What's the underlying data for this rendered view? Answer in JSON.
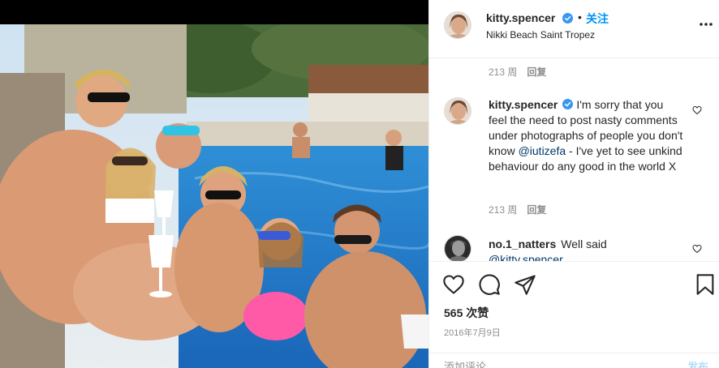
{
  "post": {
    "author": "kitty.spencer",
    "follow_label": "关注",
    "separator": "•",
    "location": "Nikki Beach Saint Tropez"
  },
  "comments": [
    {
      "meta_time": "213 周",
      "meta_reply": "回复"
    },
    {
      "username": "kitty.spencer",
      "text_before": "I'm sorry that you feel the need to post nasty comments under photographs of people you don't know ",
      "mention": "@iutizefa",
      "text_after": " - I've yet to see unkind behaviour do any good in the world X",
      "meta_time": "213 周",
      "meta_reply": "回复"
    },
    {
      "username": "no.1_natters",
      "text": "Well said",
      "mention": "@kitty.spencer"
    }
  ],
  "actions": {
    "likes": "565 次赞",
    "date": "2016年7月9日"
  },
  "add_comment": {
    "placeholder": "添加评论……",
    "post_label": "发布"
  },
  "colors": {
    "accent": "#0095f6",
    "verified": "#3897f0",
    "mention": "#00376b",
    "muted": "#8e8e8e"
  },
  "icons": [
    "verified-badge-icon",
    "more-options-icon",
    "heart-icon",
    "comment-icon",
    "share-icon",
    "bookmark-icon"
  ]
}
